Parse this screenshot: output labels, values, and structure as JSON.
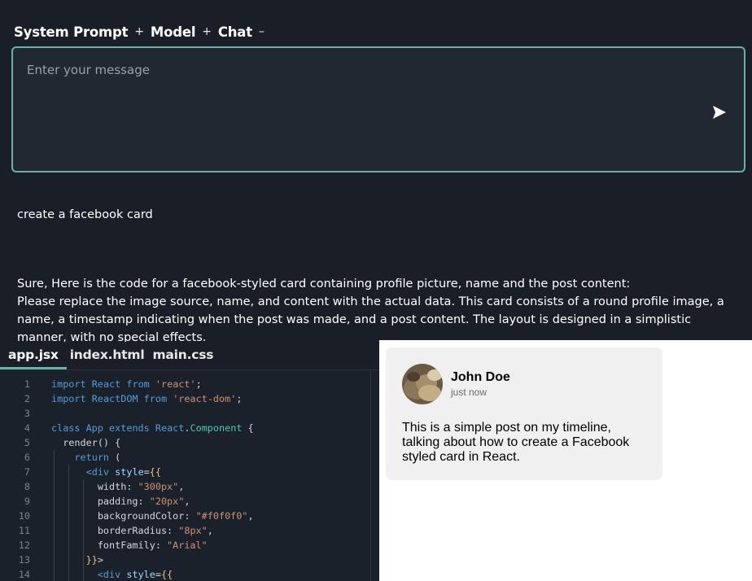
{
  "header": {
    "items": [
      {
        "label": "System Prompt",
        "toggle": "+"
      },
      {
        "label": "Model",
        "toggle": "+"
      },
      {
        "label": "Chat",
        "toggle": "–"
      }
    ]
  },
  "composer": {
    "placeholder": "Enter your message",
    "send_icon": "send-icon"
  },
  "chat": {
    "user_message": "create a facebook card",
    "assistant_message": "Sure, Here is the code for a facebook-styled card containing profile picture, name and the post content:\nPlease replace the image source, name, and content with the actual data. This card consists of a round profile image, a name, a timestamp indicating when the post was made, and a post content. The layout is designed in a simplistic manner, with no special effects."
  },
  "editor": {
    "tabs": [
      "app.jsx",
      "index.html",
      "main.css"
    ],
    "active_tab": "app.jsx",
    "lines": [
      {
        "n": "1",
        "text": "import React from 'react';"
      },
      {
        "n": "2",
        "text": "import ReactDOM from 'react-dom';"
      },
      {
        "n": "3",
        "text": ""
      },
      {
        "n": "4",
        "text": "class App extends React.Component {"
      },
      {
        "n": "5",
        "text": "  render() {"
      },
      {
        "n": "6",
        "text": "    return ("
      },
      {
        "n": "7",
        "text": "      <div style={{"
      },
      {
        "n": "8",
        "text": "        width: \"300px\","
      },
      {
        "n": "9",
        "text": "        padding: \"20px\","
      },
      {
        "n": "10",
        "text": "        backgroundColor: \"#f0f0f0\","
      },
      {
        "n": "11",
        "text": "        borderRadius: \"8px\","
      },
      {
        "n": "12",
        "text": "        fontFamily: \"Arial\""
      },
      {
        "n": "13",
        "text": "      }}>"
      },
      {
        "n": "14",
        "text": "        <div style={{"
      }
    ]
  },
  "preview": {
    "name": "John Doe",
    "timestamp": "just now",
    "post": "This is a simple post on my timeline, talking about how to create a Facebook styled card in React."
  },
  "colors": {
    "accent": "#6ab0a4",
    "background": "#1a1f27",
    "card_background": "#f0f0f0"
  }
}
